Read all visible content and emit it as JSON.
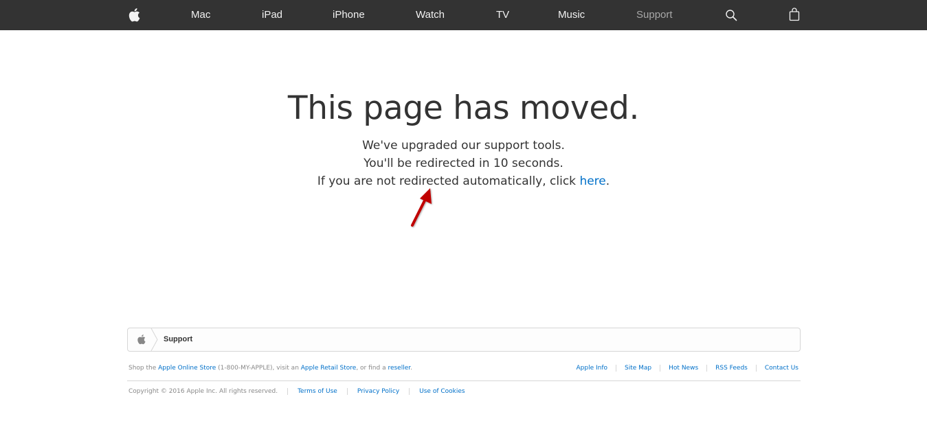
{
  "nav": {
    "items": [
      {
        "label": "Mac",
        "current": false
      },
      {
        "label": "iPad",
        "current": false
      },
      {
        "label": "iPhone",
        "current": false
      },
      {
        "label": "Watch",
        "current": false
      },
      {
        "label": "TV",
        "current": false
      },
      {
        "label": "Music",
        "current": false
      },
      {
        "label": "Support",
        "current": true
      }
    ],
    "icons": [
      "apple-logo-icon",
      "search-icon",
      "shopping-bag-icon"
    ]
  },
  "main": {
    "headline": "This page has moved.",
    "line1": "We've upgraded our support tools.",
    "line2": "You'll be redirected in 10 seconds.",
    "line3_prefix": "If you are not redirected automatically, click ",
    "line3_link": "here",
    "line3_suffix": "."
  },
  "annotation": {
    "icon": "red-arrow-icon",
    "color": "#c00000"
  },
  "footer": {
    "breadcrumb": {
      "label": "Support"
    },
    "shop": {
      "prefix": "Shop the ",
      "store_link": "Apple Online Store",
      "phone": " (1-800-MY-APPLE), visit an ",
      "retail_link": "Apple Retail Store",
      "middle": ", or find a ",
      "reseller_link": "reseller",
      "suffix": "."
    },
    "links": [
      "Apple Info",
      "Site Map",
      "Hot News",
      "RSS Feeds",
      "Contact Us"
    ],
    "copyright": "Copyright © 2016 Apple Inc. All rights reserved.",
    "legal_links": [
      "Terms of Use",
      "Privacy Policy",
      "Use of Cookies"
    ]
  },
  "colors": {
    "nav_bg": "#333333",
    "link": "#0070c9",
    "text": "#333333"
  }
}
